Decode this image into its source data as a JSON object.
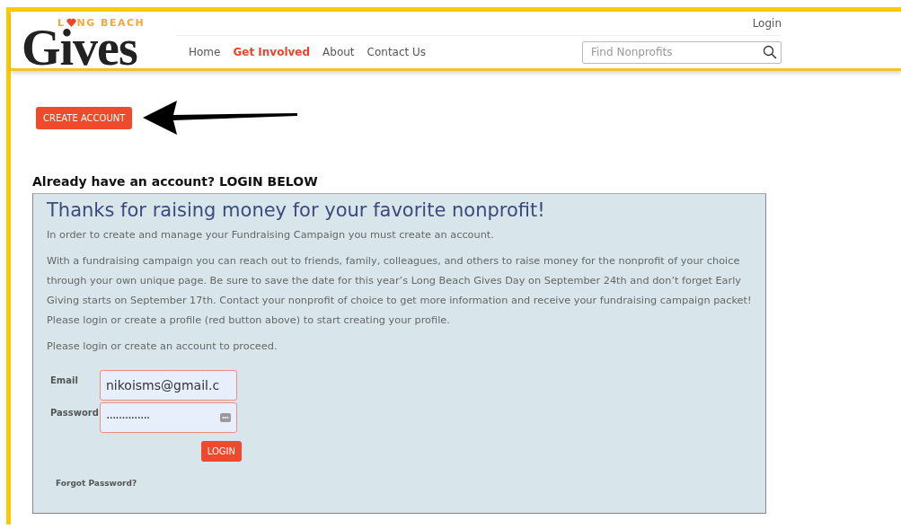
{
  "header": {
    "logo": {
      "top_left": "L",
      "top_right": "NG BEACH",
      "main": "Gives"
    },
    "login_link": "Login",
    "nav": [
      {
        "label": "Home",
        "selected": false
      },
      {
        "label": "Get Involved",
        "selected": true
      },
      {
        "label": "About",
        "selected": false
      },
      {
        "label": "Contact Us",
        "selected": false
      }
    ],
    "search": {
      "placeholder": "Find Nonprofits"
    }
  },
  "create_account_button": "CREATE ACCOUNT",
  "login_heading": "Already have an account? LOGIN BELOW",
  "panel": {
    "title": "Thanks for raising money for your favorite nonprofit!",
    "paragraphs": [
      "In order to create and manage your Fundraising Campaign you must create an account.",
      "With a fundraising campaign you can reach out to friends, family, colleagues, and others to raise money for the nonprofit of your choice through your own unique page. Be sure to save the date for this year’s Long Beach Gives Day on September 24th and don’t forget Early Giving starts on September 17th. Contact your nonprofit of choice to get more information and receive your fundraising campaign packet! Please login or create a profile (red button above) to start creating your profile.",
      "Please login or create an account to proceed."
    ],
    "form": {
      "email": {
        "label": "Email",
        "value": "nikoisms@gmail.c"
      },
      "password": {
        "label": "Password",
        "value": "··············"
      },
      "submit": "LOGIN",
      "forgot": "Forgot Password?"
    }
  }
}
